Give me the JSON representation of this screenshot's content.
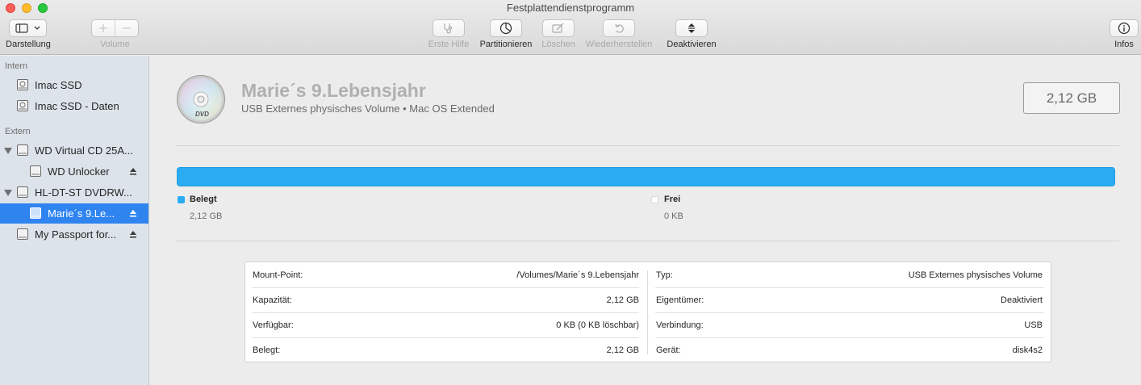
{
  "window": {
    "title": "Festplattendienstprogramm"
  },
  "toolbar": {
    "view_label": "Darstellung",
    "volume_label": "Volume",
    "first_aid_label": "Erste Hilfe",
    "partition_label": "Partitionieren",
    "erase_label": "Löschen",
    "restore_label": "Wiederherstellen",
    "unmount_label": "Deaktivieren",
    "info_label": "Infos"
  },
  "sidebar": {
    "internal_header": "Intern",
    "external_header": "Extern",
    "internal": [
      {
        "label": "Imac SSD",
        "icon": "internal-disk-icon"
      },
      {
        "label": "Imac SSD - Daten",
        "icon": "internal-disk-icon"
      }
    ],
    "external": [
      {
        "label": "WD Virtual CD 25A...",
        "icon": "external-disk-icon",
        "expanded": true
      },
      {
        "label": "WD Unlocker",
        "icon": "volume-icon",
        "eject": true
      },
      {
        "label": "HL-DT-ST DVDRW...",
        "icon": "external-disk-icon",
        "expanded": true
      },
      {
        "label": "Marie´s 9.Le...",
        "icon": "volume-icon",
        "eject": true,
        "selected": true
      },
      {
        "label": "My Passport for...",
        "icon": "external-disk-icon",
        "eject": true
      }
    ]
  },
  "volume": {
    "name": "Marie´s 9.Lebensjahr",
    "subtitle": "USB Externes physisches Volume • Mac OS Extended",
    "capacity": "2,12 GB",
    "icon": "dvd-disc-icon",
    "icon_text": "DVD"
  },
  "usage": {
    "used_fraction": 1.0,
    "used_color": "#2bacf2",
    "used_label": "Belegt",
    "used_value": "2,12 GB",
    "free_label": "Frei",
    "free_value": "0 KB"
  },
  "info": {
    "left": [
      {
        "key": "Mount-Point:",
        "value": "/Volumes/Marie´s 9.Lebensjahr"
      },
      {
        "key": "Kapazität:",
        "value": "2,12 GB"
      },
      {
        "key": "Verfügbar:",
        "value": "0 KB (0 KB löschbar)"
      },
      {
        "key": "Belegt:",
        "value": "2,12 GB"
      }
    ],
    "right": [
      {
        "key": "Typ:",
        "value": "USB Externes physisches Volume"
      },
      {
        "key": "Eigentümer:",
        "value": "Deaktiviert"
      },
      {
        "key": "Verbindung:",
        "value": "USB"
      },
      {
        "key": "Gerät:",
        "value": "disk4s2"
      }
    ]
  }
}
